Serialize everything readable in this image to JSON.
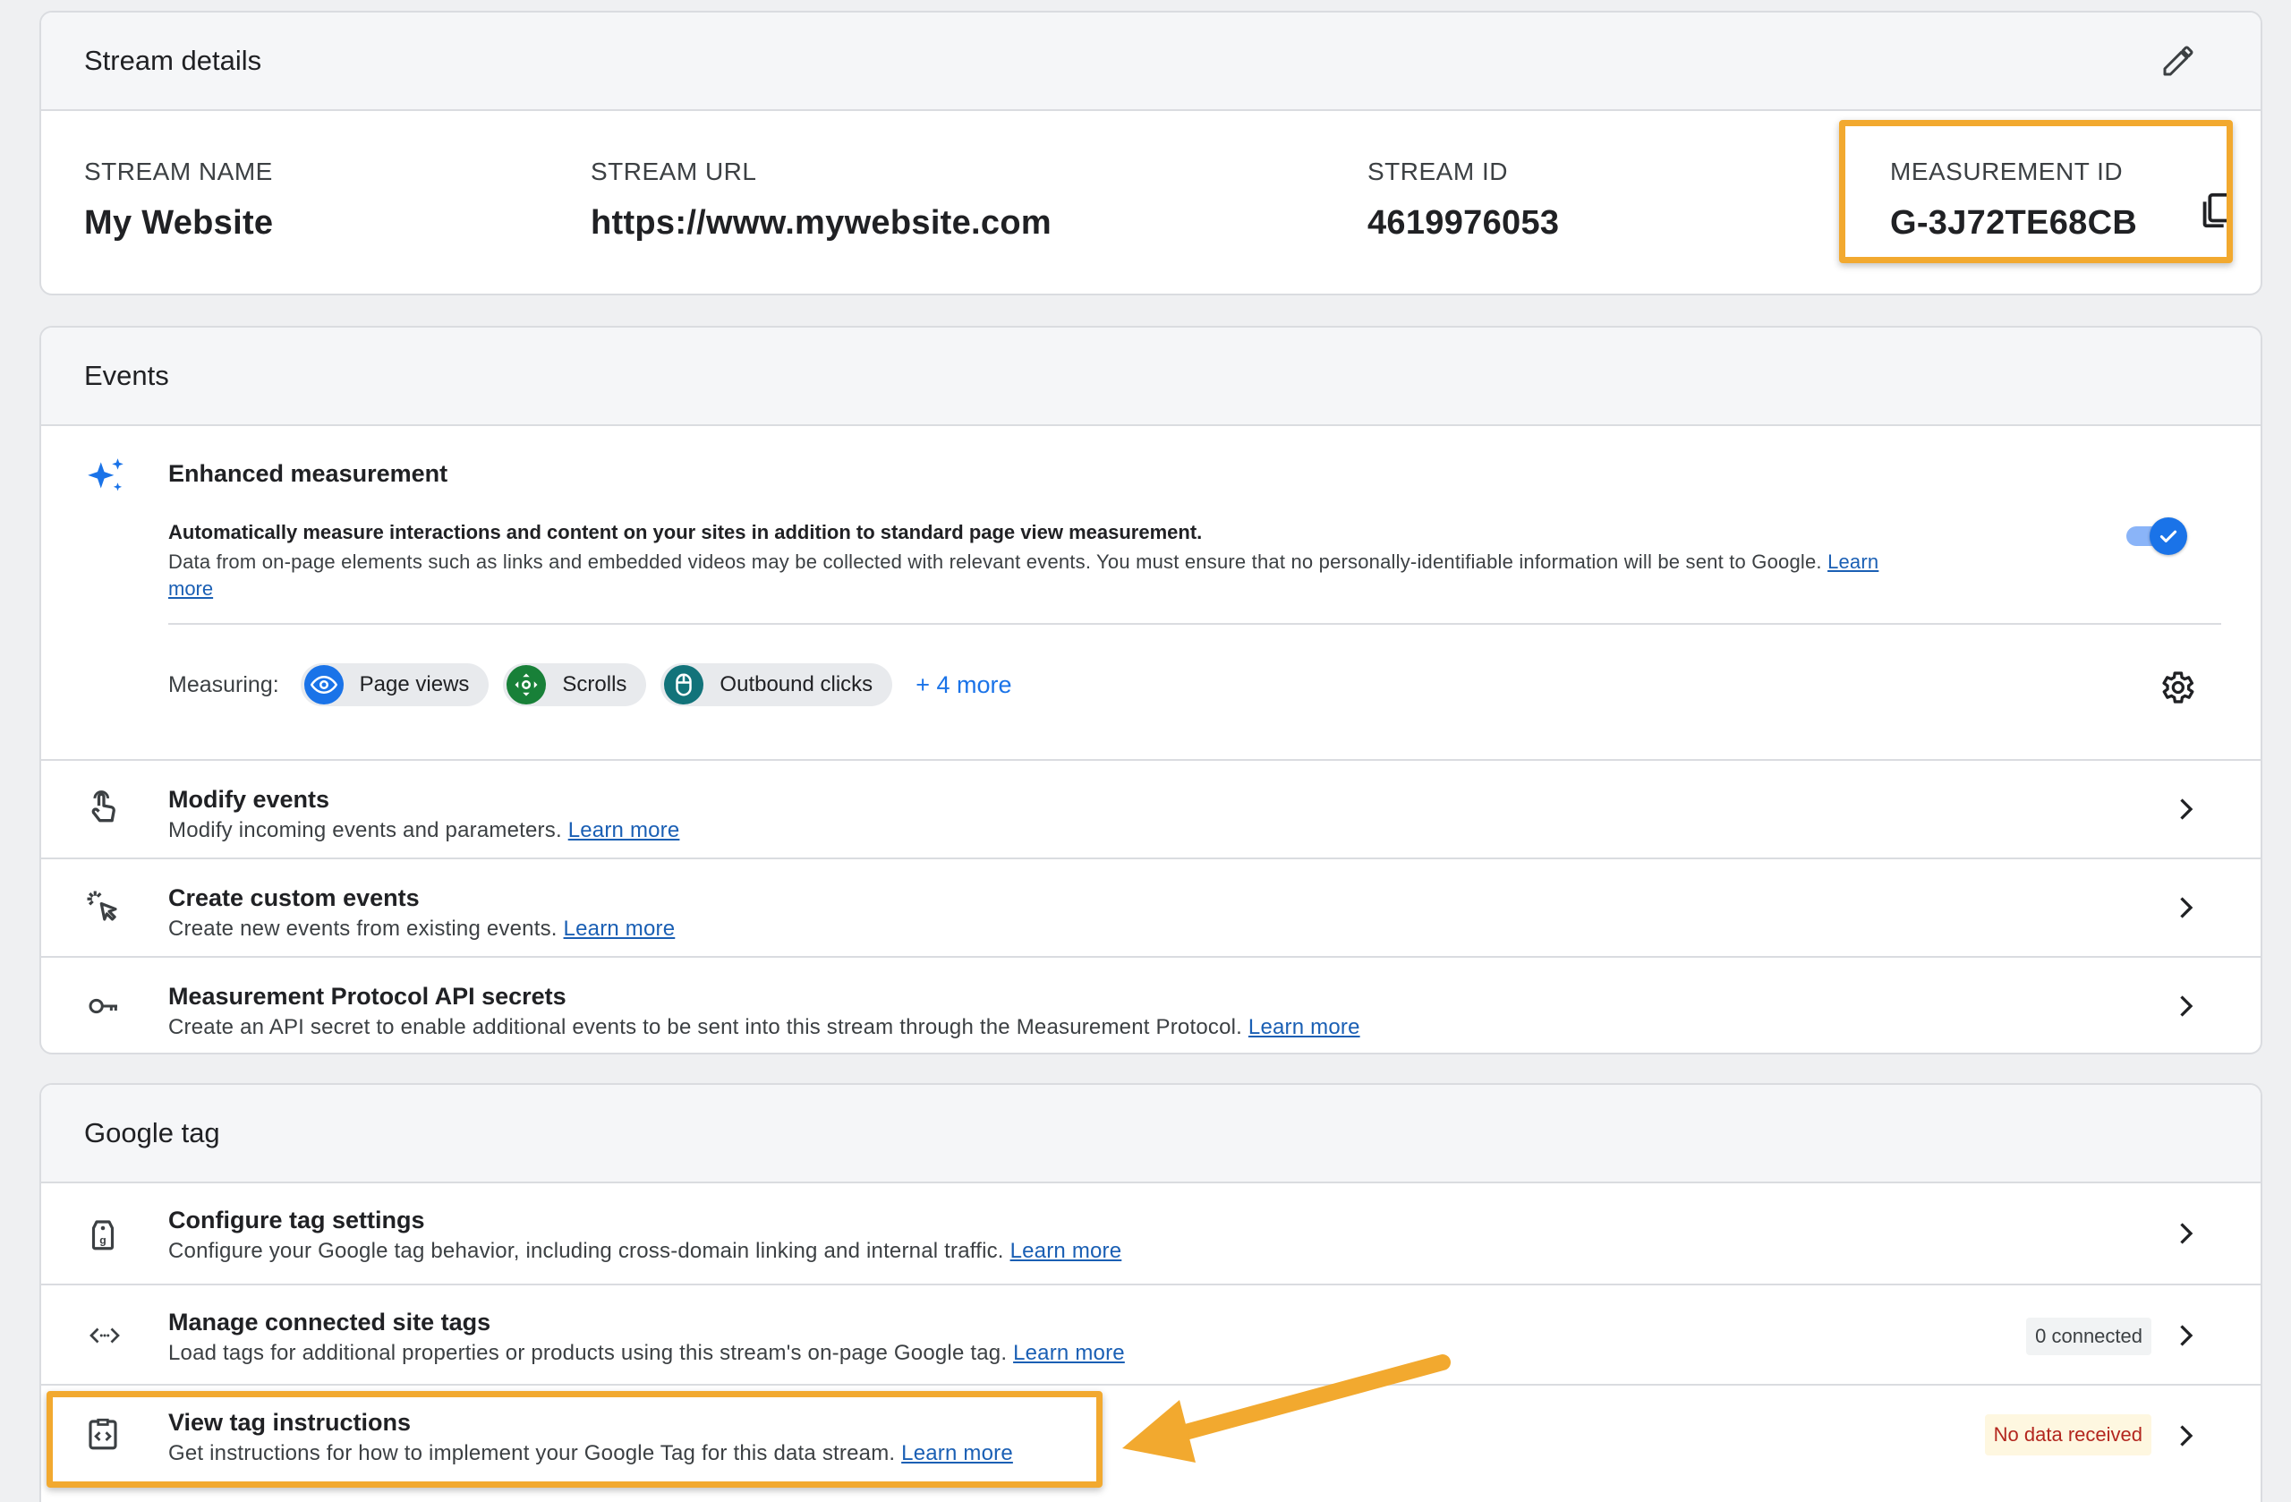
{
  "stream_details": {
    "title": "Stream details",
    "columns": [
      {
        "label": "STREAM NAME",
        "value": "My Website"
      },
      {
        "label": "STREAM URL",
        "value": "https://www.mywebsite.com"
      },
      {
        "label": "STREAM ID",
        "value": "4619976053"
      },
      {
        "label": "MEASUREMENT ID",
        "value": "G-3J72TE68CB"
      }
    ]
  },
  "events": {
    "title": "Events",
    "enhanced": {
      "title": "Enhanced measurement",
      "desc_bold": "Automatically measure interactions and content on your sites in addition to standard page view measurement.",
      "desc": "Data from on-page elements such as links and embedded videos may be collected with relevant events. You must ensure that no personally-identifiable information will be sent to Google.",
      "learn_1": "Learn",
      "learn_2": "more",
      "toggle_on": true,
      "measuring_label": "Measuring:",
      "chips": [
        "Page views",
        "Scrolls",
        "Outbound clicks"
      ],
      "more": "+ 4 more"
    },
    "rows": [
      {
        "title": "Modify events",
        "desc": "Modify incoming events and parameters.",
        "link": "Learn more"
      },
      {
        "title": "Create custom events",
        "desc": "Create new events from existing events.",
        "link": "Learn more"
      },
      {
        "title": "Measurement Protocol API secrets",
        "desc": "Create an API secret to enable additional events to be sent into this stream through the Measurement Protocol.",
        "link": "Learn more"
      }
    ]
  },
  "google_tag": {
    "title": "Google tag",
    "rows": [
      {
        "title": "Configure tag settings",
        "desc": "Configure your Google tag behavior, including cross-domain linking and internal traffic.",
        "link": "Learn more"
      },
      {
        "title": "Manage connected site tags",
        "desc": "Load tags for additional properties or products using this stream's on-page Google tag.",
        "link": "Learn more",
        "badge": "0 connected"
      },
      {
        "title": "View tag instructions",
        "desc": "Get instructions for how to implement your Google Tag for this data stream.",
        "link": "Learn more",
        "badge": "No data received"
      }
    ]
  },
  "colors": {
    "accent": "#1a73e8",
    "highlight": "#f2a92f",
    "warning_bg": "#fef7e0",
    "warning_text": "#b3261e"
  }
}
